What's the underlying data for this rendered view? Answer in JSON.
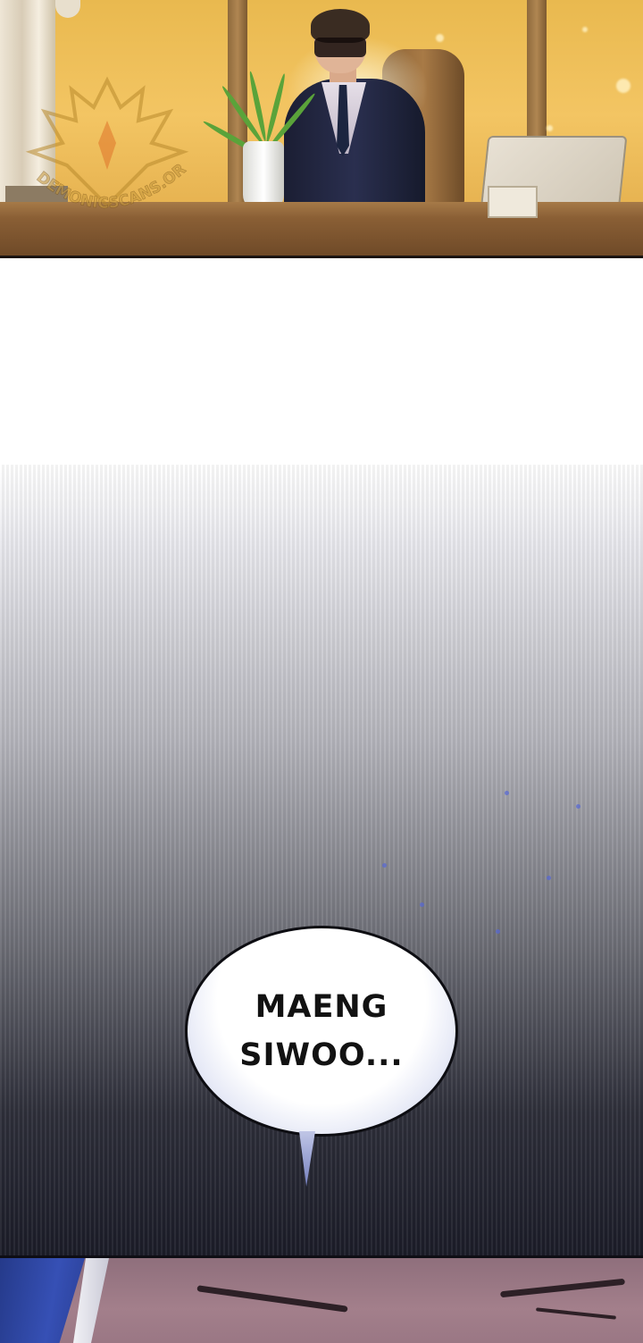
{
  "panels": [
    {
      "id": "office-scene"
    },
    {
      "id": "speech-scene",
      "speech_bubble": {
        "text": "MAENG\nSIWOO..."
      }
    },
    {
      "id": "closeup-scene"
    }
  ],
  "watermark": {
    "text": "DEMONICSCANS.ORG"
  },
  "colors": {
    "office_light": "#f3c563",
    "desk": "#8a5f35",
    "suit": "#1b1e33",
    "bubble_fill": "#ffffff",
    "bubble_outline": "#0d0d12",
    "dark_bottom": "#1b1c28",
    "speck": "#5567d6",
    "closeup_skin": "#a37f8b",
    "closeup_blue": "#3650b5"
  }
}
